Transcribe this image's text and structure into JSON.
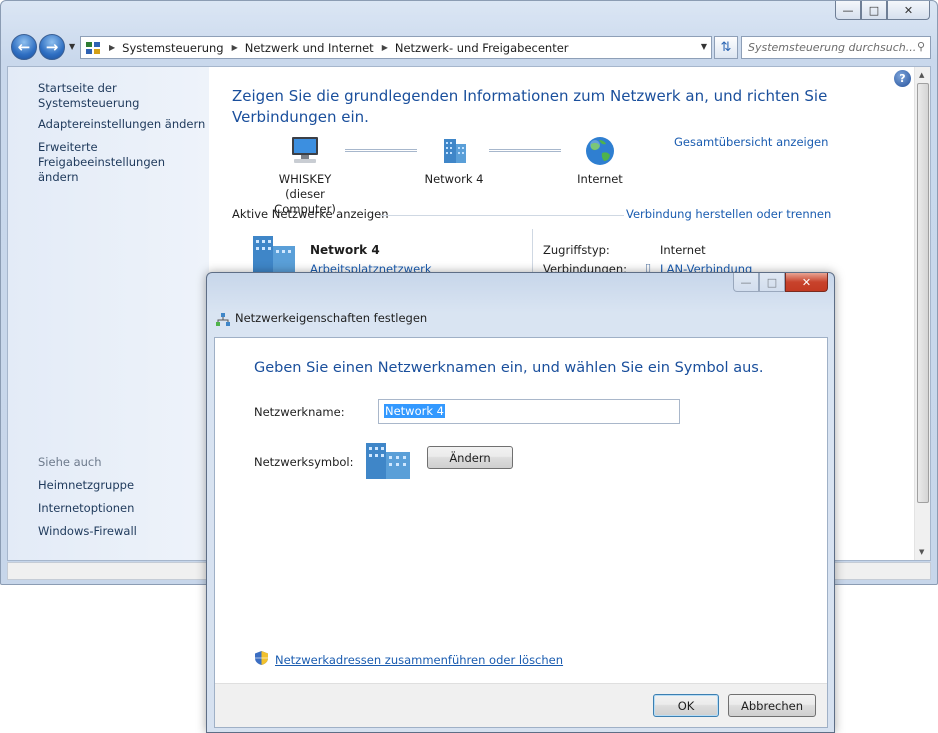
{
  "window": {
    "address": {
      "crumbs": [
        "Systemsteuerung",
        "Netzwerk und Internet",
        "Netzwerk- und Freigabecenter"
      ]
    },
    "search": {
      "placeholder": "Systemsteuerung durchsuch..."
    },
    "sidebar": {
      "home": "Startseite der Systemsteuerung",
      "adapter": "Adaptereinstellungen ändern",
      "advanced_line1": "Erweiterte",
      "advanced_line2": "Freigabeeinstellungen ändern",
      "see_also": "Siehe auch",
      "links": [
        "Heimnetzgruppe",
        "Internetoptionen",
        "Windows-Firewall"
      ]
    },
    "main": {
      "heading": "Zeigen Sie die grundlegenden Informationen zum Netzwerk an, und richten Sie Verbindungen ein.",
      "overview_link": "Gesamtübersicht anzeigen",
      "map": {
        "computer_name": "WHISKEY",
        "computer_sub": "(dieser Computer)",
        "network": "Network  4",
        "internet": "Internet"
      },
      "active_networks_label": "Aktive Netzwerke anzeigen",
      "connect_link": "Verbindung herstellen oder trennen",
      "network_name": "Network  4",
      "network_type": "Arbeitsplatznetzwerk",
      "access_type_label": "Zugriffstyp:",
      "access_type_value": "Internet",
      "connections_label": "Verbindungen:",
      "connections_value": "LAN-Verbindung"
    }
  },
  "dialog": {
    "title": "Netzwerkeigenschaften festlegen",
    "heading": "Geben Sie einen Netzwerknamen ein, und wählen Sie ein Symbol aus.",
    "name_label": "Netzwerkname:",
    "name_value": "Network  4",
    "symbol_label": "Netzwerksymbol:",
    "change_button": "Ändern",
    "merge_link": "Netzwerkadressen zusammenführen oder löschen",
    "ok_button": "OK",
    "cancel_button": "Abbrechen"
  },
  "colors": {
    "link": "#1a5cb0",
    "heading": "#1a4f9c",
    "selection": "#3399ff",
    "close_button": "#c8432c"
  }
}
